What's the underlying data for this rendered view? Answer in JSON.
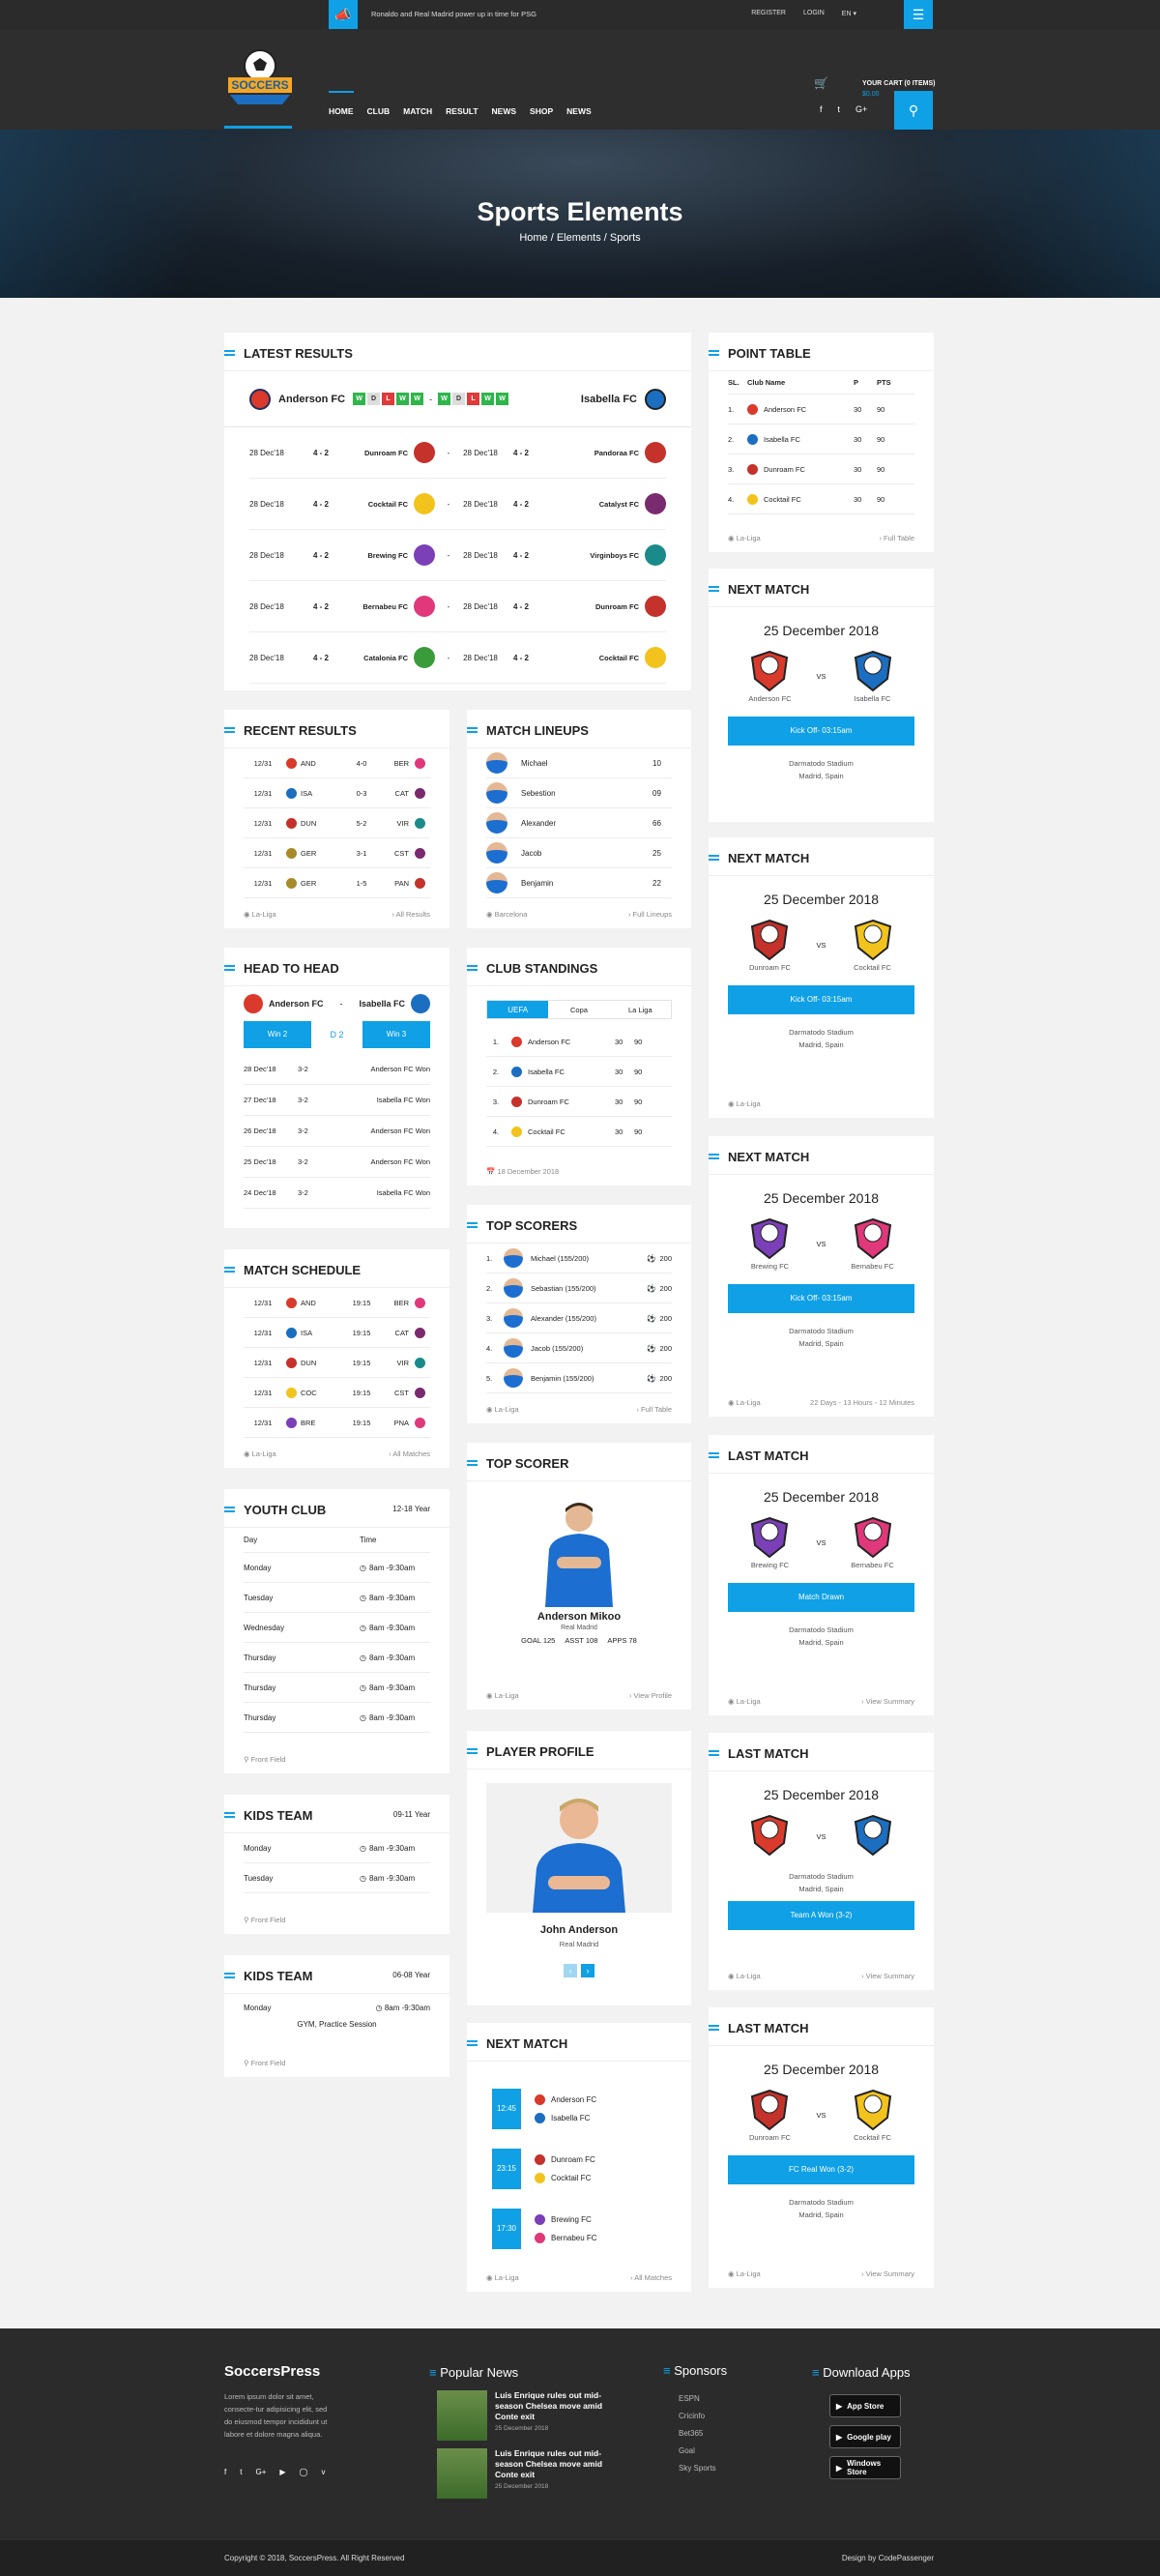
{
  "header": {
    "ticker": "Ronaldo and Real Madrid power up in time for PSG",
    "register": "REGISTER",
    "login": "LOGIN",
    "lang": "EN",
    "cart_title": "YOUR CART (0 ITEMS)",
    "cart_amount": "$0.00",
    "logo_text": "SOCCERS"
  },
  "nav": [
    "HOME",
    "CLUB",
    "MATCH",
    "RESULT",
    "NEWS",
    "SHOP",
    "NEWS"
  ],
  "hero": {
    "title": "Sports Elements",
    "breadcrumb": "Home / Elements / Sports"
  },
  "latest": {
    "title": "LATEST RESULTS",
    "home": "Anderson FC",
    "away": "Isabella FC",
    "form_home": [
      "W",
      "D",
      "L",
      "W",
      "W"
    ],
    "form_away": [
      "W",
      "D",
      "L",
      "W",
      "W"
    ],
    "rows": [
      [
        "28 Dec'18",
        "4 - 2",
        "Dunroam FC",
        "28 Dec'18",
        "4 - 2",
        "Pandoraa FC"
      ],
      [
        "28 Dec'18",
        "4 - 2",
        "Cocktail FC",
        "28 Dec'18",
        "4 - 2",
        "Catalyst FC"
      ],
      [
        "28 Dec'18",
        "4 - 2",
        "Brewing FC",
        "28 Dec'18",
        "4 - 2",
        "Virginboys FC"
      ],
      [
        "28 Dec'18",
        "4 - 2",
        "Bernabeu FC",
        "28 Dec'18",
        "4 - 2",
        "Dunroam FC"
      ],
      [
        "28 Dec'18",
        "4 - 2",
        "Catalonia FC",
        "28 Dec'18",
        "4 - 2",
        "Cocktail FC"
      ]
    ]
  },
  "point": {
    "title": "POINT TABLE",
    "headers": [
      "SL.",
      "Club Name",
      "P",
      "PTS"
    ],
    "rows": [
      [
        "1.",
        "Anderson FC",
        "30",
        "90"
      ],
      [
        "2.",
        "Isabella FC",
        "30",
        "90"
      ],
      [
        "3.",
        "Dunroam FC",
        "30",
        "90"
      ],
      [
        "4.",
        "Cocktail FC",
        "30",
        "90"
      ]
    ],
    "foot_l": "La-Liga",
    "foot_r": "Full Table"
  },
  "recent": {
    "title": "RECENT RESULTS",
    "rows": [
      [
        "12/31",
        "AND",
        "4-0",
        "BER"
      ],
      [
        "12/31",
        "ISA",
        "0-3",
        "CAT"
      ],
      [
        "12/31",
        "DUN",
        "5-2",
        "VIR"
      ],
      [
        "12/31",
        "GER",
        "3-1",
        "CST"
      ],
      [
        "12/31",
        "GER",
        "1-5",
        "PAN"
      ]
    ],
    "foot_l": "La-Liga",
    "foot_r": "All Results"
  },
  "lineups": {
    "title": "MATCH LINEUPS",
    "rows": [
      [
        "Michael",
        "10"
      ],
      [
        "Sebestion",
        "09"
      ],
      [
        "Alexander",
        "66"
      ],
      [
        "Jacob",
        "25"
      ],
      [
        "Benjamin",
        "22"
      ]
    ],
    "foot_l": "Barcelona",
    "foot_r": "Full Lineups"
  },
  "h2h": {
    "title": "HEAD TO HEAD",
    "home": "Anderson FC",
    "away": "Isabella FC",
    "b1": "Win 2",
    "b2": "D 2",
    "b3": "Win 3",
    "rows": [
      [
        "28 Dec'18",
        "3-2",
        "Anderson FC Won"
      ],
      [
        "27 Dec'18",
        "3-2",
        "Isabella FC Won"
      ],
      [
        "26 Dec'18",
        "3-2",
        "Anderson FC Won"
      ],
      [
        "25 Dec'18",
        "3-2",
        "Anderson FC Won"
      ],
      [
        "24 Dec'18",
        "3-2",
        "Isabella FC Won"
      ]
    ]
  },
  "standings": {
    "title": "CLUB STANDINGS",
    "tabs": [
      "UEFA",
      "Copa",
      "La Liga"
    ],
    "rows": [
      [
        "1.",
        "Anderson FC",
        "30",
        "90"
      ],
      [
        "2.",
        "Isabella FC",
        "30",
        "90"
      ],
      [
        "3.",
        "Dunroam FC",
        "30",
        "90"
      ],
      [
        "4.",
        "Cocktail FC",
        "30",
        "90"
      ]
    ],
    "foot": "18 December 2018"
  },
  "schedule": {
    "title": "MATCH SCHEDULE",
    "rows": [
      [
        "12/31",
        "AND",
        "19:15",
        "BER"
      ],
      [
        "12/31",
        "ISA",
        "19:15",
        "CAT"
      ],
      [
        "12/31",
        "DUN",
        "19:15",
        "VIR"
      ],
      [
        "12/31",
        "COC",
        "19:15",
        "CST"
      ],
      [
        "12/31",
        "BRE",
        "19:15",
        "PNA"
      ]
    ],
    "foot_l": "La-Liga",
    "foot_r": "All Matches"
  },
  "scorers": {
    "title": "TOP SCORERS",
    "rows": [
      [
        "1.",
        "Michael (155/200)",
        "200"
      ],
      [
        "2.",
        "Sebastian (155/200)",
        "200"
      ],
      [
        "3.",
        "Alexander (155/200)",
        "200"
      ],
      [
        "4.",
        "Jacob (155/200)",
        "200"
      ],
      [
        "5.",
        "Benjamin (155/200)",
        "200"
      ]
    ],
    "foot_l": "La-Liga",
    "foot_r": "Full Table"
  },
  "youth": {
    "title": "YOUTH CLUB",
    "age": "12-18 Year",
    "h1": "Day",
    "h2": "Time",
    "rows": [
      [
        "Monday",
        "8am -9:30am"
      ],
      [
        "Tuesday",
        "8am -9:30am"
      ],
      [
        "Wednesday",
        "8am -9:30am"
      ],
      [
        "Thursday",
        "8am -9:30am"
      ],
      [
        "Thursday",
        "8am -9:30am"
      ],
      [
        "Thursday",
        "8am -9:30am"
      ]
    ],
    "foot": "Front Field"
  },
  "topscorer": {
    "title": "TOP SCORER",
    "name": "Anderson Mikoo",
    "club": "Real Madrid",
    "stats": "GOAL 125     ASST 108     APPS 78",
    "foot_l": "La-Liga",
    "foot_r": "View Profile"
  },
  "kids1": {
    "title": "KIDS TEAM",
    "age": "09-11 Year",
    "rows": [
      [
        "Monday",
        "8am -9:30am"
      ],
      [
        "Tuesday",
        "8am -9:30am"
      ]
    ],
    "foot": "Front Field"
  },
  "kids2": {
    "title": "KIDS TEAM",
    "age": "06-08 Year",
    "rows": [
      [
        "Monday",
        "8am -9:30am"
      ]
    ],
    "note": "GYM, Practice Session",
    "foot": "Front Field"
  },
  "profile": {
    "title": "PLAYER PROFILE",
    "name": "John Anderson",
    "club": "Real Madrid"
  },
  "nextlist": {
    "title": "NEXT MATCH",
    "items": [
      [
        "12:45",
        "Anderson FC",
        "Isabella FC"
      ],
      [
        "23:15",
        "Dunroam FC",
        "Cocktail FC"
      ],
      [
        "17:30",
        "Brewing FC",
        "Bernabeu FC"
      ]
    ],
    "foot_l": "La-Liga",
    "foot_r": "All Matches"
  },
  "matches": [
    {
      "title": "NEXT MATCH",
      "date": "25 December 2018",
      "home": "Anderson FC",
      "away": "Isabella FC",
      "btn": "Kick Off- 03:15am",
      "venue": "Darmatodo Stadium",
      "city": "Madrid, Spain",
      "foot_l": "",
      "foot_r": ""
    },
    {
      "title": "NEXT MATCH",
      "date": "25 December 2018",
      "home": "Dunroam FC",
      "away": "Cocktail FC",
      "btn": "Kick Off- 03:15am",
      "venue": "Darmatodo Stadium",
      "city": "Madrid, Spain",
      "foot_l": "La-Liga",
      "foot_r": ""
    },
    {
      "title": "NEXT MATCH",
      "date": "25 December 2018",
      "home": "Brewing FC",
      "away": "Bernabeu FC",
      "btn": "Kick Off- 03:15am",
      "venue": "Darmatodo Stadium",
      "city": "Madrid, Spain",
      "foot_l": "La-Liga",
      "foot_r": "22 Days - 13 Hours - 12 Minutes"
    },
    {
      "title": "LAST MATCH",
      "date": "25 December 2018",
      "home": "Brewing FC",
      "away": "Bernabeu FC",
      "btn": "Match Drawn",
      "venue": "Darmatodo Stadium",
      "city": "Madrid, Spain",
      "foot_l": "La-Liga",
      "foot_r": "View Summary"
    },
    {
      "title": "LAST MATCH",
      "date": "25 December 2018",
      "home": "",
      "away": "",
      "btn": "Team A Won (3-2)",
      "venue": "Darmatodo Stadium",
      "city": "Madrid, Spain",
      "foot_l": "La-Liga",
      "foot_r": "View Summary"
    },
    {
      "title": "LAST MATCH",
      "date": "25 December 2018",
      "home": "Dunroam FC",
      "away": "Cocktail FC",
      "btn": "FC Real Won (3-2)",
      "venue": "Darmatodo Stadium",
      "city": "Madrid, Spain",
      "foot_l": "La-Liga",
      "foot_r": "View Summary"
    }
  ],
  "footer": {
    "brand": "SoccersPress",
    "about": "Lorem ipsum dolor sit amet, consecte-tur adipisicing elit, sed do eiusmod tempor incididunt ut labore et dolore magna aliqua.",
    "news_title": "Popular News",
    "news": [
      [
        "Luis Enrique rules out mid-season Chelsea move amid Conte exit",
        "25 December 2018"
      ],
      [
        "Luis Enrique rules out mid-season Chelsea move amid Conte exit",
        "25 December 2018"
      ]
    ],
    "sponsors_title": "Sponsors",
    "sponsors": [
      "ESPN",
      "Cricinfo",
      "Bet365",
      "Goal",
      "Sky Sports"
    ],
    "apps_title": "Download Apps",
    "apps": [
      "App Store",
      "Google play",
      "Windows Store"
    ],
    "copyright": "Copyright © 2018, SoccersPress. All Right Reserved",
    "credit": "Design by CodePassenger"
  },
  "colors": {
    "accent": "#0fa0e6",
    "dark": "#2b2b2b"
  }
}
